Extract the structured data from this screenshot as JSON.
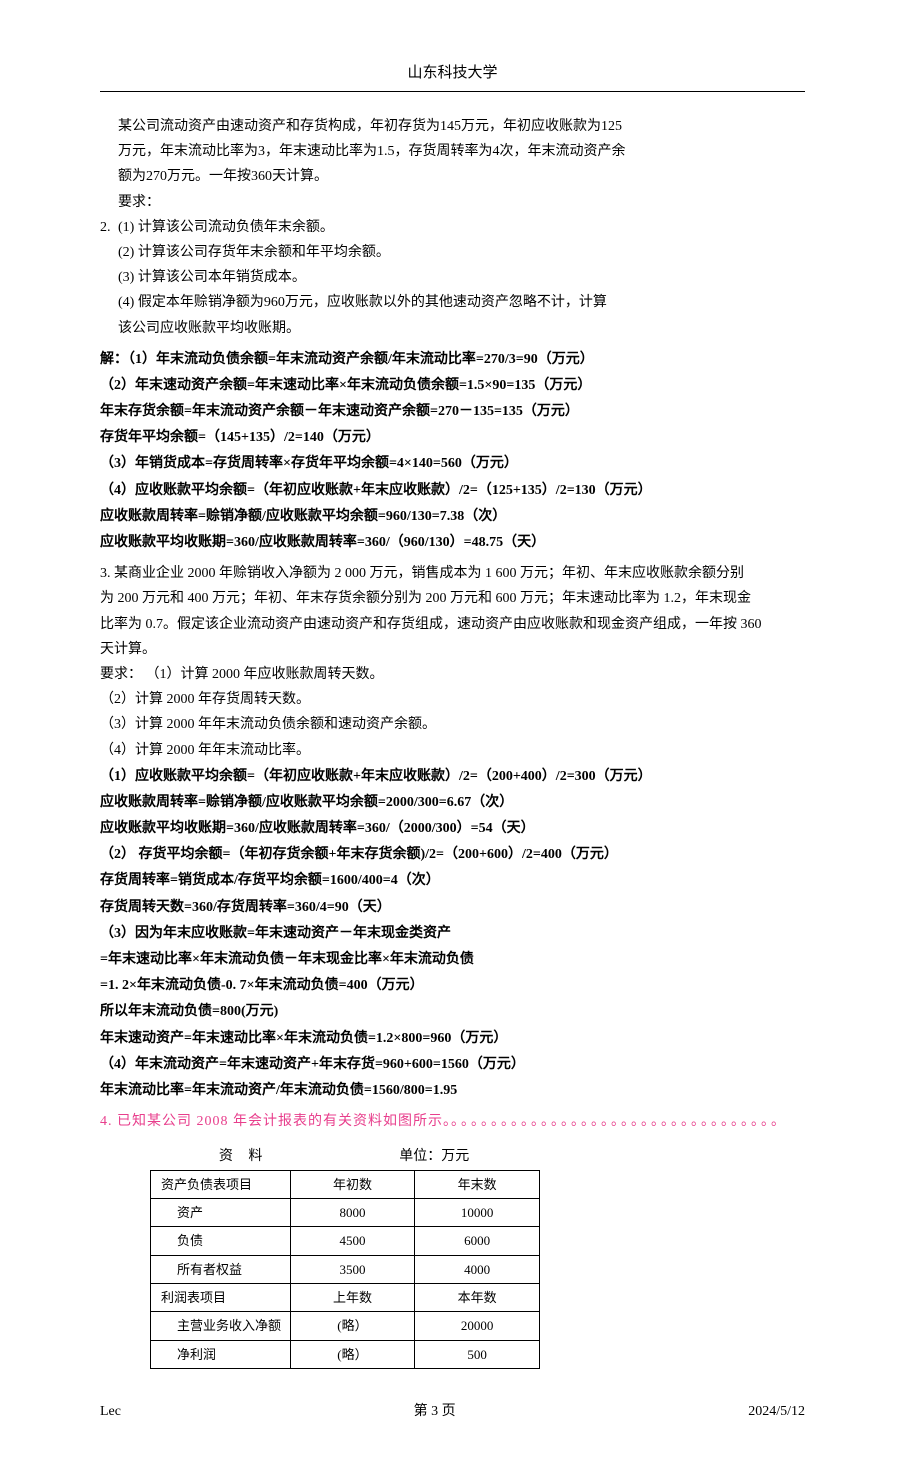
{
  "header": {
    "title": "山东科技大学"
  },
  "q2": {
    "num": "2.",
    "stem": [
      "某公司流动资产由速动资产和存货构成，年初存货为145万元，年初应收账款为125",
      "万元，年末流动比率为3，年末速动比率为1.5，存货周转率为4次，年末流动资产余",
      "额为270万元。一年按360天计算。",
      "要求：",
      "(1) 计算该公司流动负债年末余额。",
      "(2) 计算该公司存货年末余额和年平均余额。",
      "(3) 计算该公司本年销货成本。",
      "(4) 假定本年赊销净额为960万元，应收账款以外的其他速动资产忽略不计，计算",
      "该公司应收账款平均收账期。"
    ],
    "sol": [
      "解：（1）年末流动负债余额=年末流动资产余额/年末流动比率=270/3=90（万元）",
      "（2）年末速动资产余额=年末速动比率×年末流动负债余额=1.5×90=135（万元）",
      "年末存货余额=年末流动资产余额－年末速动资产余额=270－135=135（万元）",
      "存货年平均余额=（145+135）/2=140（万元）",
      "（3）年销货成本=存货周转率×存货年平均余额=4×140=560（万元）",
      "（4）应收账款平均余额=（年初应收账款+年末应收账款）/2=（125+135）/2=130（万元）",
      "应收账款周转率=赊销净额/应收账款平均余额=960/130=7.38（次）",
      "应收账款平均收账期=360/应收账款周转率=360/（960/130）=48.75（天）"
    ]
  },
  "q3": {
    "stem": [
      "3. 某商业企业 2000 年赊销收入净额为 2 000 万元，销售成本为 1 600 万元；年初、年末应收账款余额分别",
      "为 200 万元和 400 万元；年初、年末存货余额分别为 200 万元和 600 万元；年末速动比率为 1.2，年末现金",
      "比率为 0.7。假定该企业流动资产由速动资产和存货组成，速动资产由应收账款和现金资产组成，一年按 360",
      "天计算。"
    ],
    "req_label": "要求：",
    "req": [
      "（1）计算 2000 年应收账款周转天数。",
      "（2）计算 2000 年存货周转天数。",
      "（3）计算 2000 年年末流动负债余额和速动资产余额。",
      "（4）计算 2000 年年末流动比率。"
    ],
    "sol": [
      "（1）应收账款平均余额=（年初应收账款+年末应收账款）/2=（200+400）/2=300（万元）",
      "应收账款周转率=赊销净额/应收账款平均余额=2000/300=6.67（次）",
      "应收账款平均收账期=360/应收账款周转率=360/（2000/300）=54（天）",
      "（2） 存货平均余额=（年初存货余额+年末存货余额)/2=（200+600）/2=400（万元）",
      "存货周转率=销货成本/存货平均余额=1600/400=4（次）",
      "存货周转天数=360/存货周转率=360/4=90（天）",
      "（3）因为年末应收账款=年末速动资产－年末现金类资产",
      "=年末速动比率×年末流动负债－年末现金比率×年末流动负债",
      "=1. 2×年末流动负债-0. 7×年末流动负债=400（万元）",
      "所以年末流动负债=800(万元)",
      "年末速动资产=年末速动比率×年末流动负债=1.2×800=960（万元）",
      "（4）年末流动资产=年末速动资产+年末存货=960+600=1560（万元）",
      "年末流动比率=年末流动资产/年末流动负债=1560/800=1.95"
    ]
  },
  "q4": {
    "line": "4. 已知某公司 2008 年会计报表的有关资料如图所示。",
    "dots": "。。。。。。。。。。。。。。。。。。。。。。。。。。。。。。。。。"
  },
  "table": {
    "caption_left": "资 料",
    "caption_right": "单位：万元",
    "rows": [
      {
        "label": "资产负债表项目",
        "c1": "年初数",
        "c2": "年末数",
        "indent": false
      },
      {
        "label": "资产",
        "c1": "8000",
        "c2": "10000",
        "indent": true
      },
      {
        "label": "负债",
        "c1": "4500",
        "c2": "6000",
        "indent": true
      },
      {
        "label": "所有者权益",
        "c1": "3500",
        "c2": "4000",
        "indent": true
      },
      {
        "label": "利润表项目",
        "c1": "上年数",
        "c2": "本年数",
        "indent": false
      },
      {
        "label": "主营业务收入净额",
        "c1": "(略）",
        "c2": "20000",
        "indent": true
      },
      {
        "label": "净利润",
        "c1": "(略）",
        "c2": "500",
        "indent": true
      }
    ]
  },
  "footer": {
    "left": "Lec",
    "center": "第 3 页",
    "right": "2024/5/12"
  }
}
